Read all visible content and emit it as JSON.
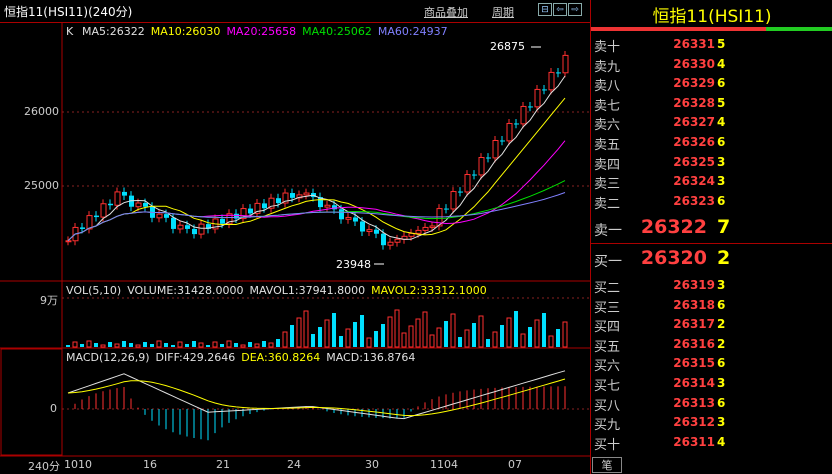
{
  "window": {
    "title": "恒指11(HSI11)(240分)",
    "links": [
      "商品叠加",
      "周期"
    ],
    "buttons": [
      "⊟",
      "⇦",
      "⇨",
      "✕"
    ]
  },
  "kline": {
    "label": "K",
    "ma": [
      {
        "text": "MA5:26322",
        "color": "#e0e0e0"
      },
      {
        "text": "MA10:26030",
        "color": "#ffff00"
      },
      {
        "text": "MA20:25658",
        "color": "#ff00ff"
      },
      {
        "text": "MA40:25062",
        "color": "#00e000"
      },
      {
        "text": "MA60:24937",
        "color": "#8080ff"
      }
    ],
    "high_label": "26875",
    "low_label": "23948",
    "y_ticks": [
      "26000",
      "25000"
    ]
  },
  "volume": {
    "legend": [
      {
        "text": "VOL(5,10)",
        "color": "#e0e0e0"
      },
      {
        "text": "VOLUME:31428.0000",
        "color": "#e0e0e0"
      },
      {
        "text": "MAVOL1:37941.8000",
        "color": "#e0e0e0"
      },
      {
        "text": "MAVOL2:33312.1000",
        "color": "#ffff00"
      }
    ],
    "y_tick": "9万"
  },
  "macd": {
    "legend": [
      {
        "text": "MACD(12,26,9)",
        "color": "#e0e0e0"
      },
      {
        "text": "DIFF:429.2646",
        "color": "#e0e0e0"
      },
      {
        "text": "DEA:360.8264",
        "color": "#ffff00"
      },
      {
        "text": "MACD:136.8764",
        "color": "#e0e0e0"
      }
    ],
    "y_tick": "0"
  },
  "x_axis": {
    "period": "240分",
    "ticks": [
      "1010",
      "16",
      "21",
      "24",
      "30",
      "1104",
      "07"
    ]
  },
  "order_book": {
    "title": "恒指11(HSI11)",
    "asks": [
      {
        "label": "卖十",
        "price": "26331",
        "vol": "5"
      },
      {
        "label": "卖九",
        "price": "26330",
        "vol": "4"
      },
      {
        "label": "卖八",
        "price": "26329",
        "vol": "6"
      },
      {
        "label": "卖七",
        "price": "26328",
        "vol": "5"
      },
      {
        "label": "卖六",
        "price": "26327",
        "vol": "4"
      },
      {
        "label": "卖五",
        "price": "26326",
        "vol": "6"
      },
      {
        "label": "卖四",
        "price": "26325",
        "vol": "3"
      },
      {
        "label": "卖三",
        "price": "26324",
        "vol": "3"
      },
      {
        "label": "卖二",
        "price": "26323",
        "vol": "6"
      }
    ],
    "best_ask": {
      "label": "卖一",
      "price": "26322",
      "vol": "7"
    },
    "best_bid": {
      "label": "买一",
      "price": "26320",
      "vol": "2"
    },
    "bids": [
      {
        "label": "买二",
        "price": "26319",
        "vol": "3"
      },
      {
        "label": "买三",
        "price": "26318",
        "vol": "6"
      },
      {
        "label": "买四",
        "price": "26317",
        "vol": "2"
      },
      {
        "label": "买五",
        "price": "26316",
        "vol": "2"
      },
      {
        "label": "买六",
        "price": "26315",
        "vol": "6"
      },
      {
        "label": "买七",
        "price": "26314",
        "vol": "3"
      },
      {
        "label": "买八",
        "price": "26313",
        "vol": "6"
      },
      {
        "label": "买九",
        "price": "26312",
        "vol": "3"
      },
      {
        "label": "买十",
        "price": "26311",
        "vol": "4"
      }
    ],
    "footer_tab": "笔"
  },
  "colors": {
    "up": "#ff3030",
    "down": "#00e0ff",
    "frame": "#aa0000"
  }
}
